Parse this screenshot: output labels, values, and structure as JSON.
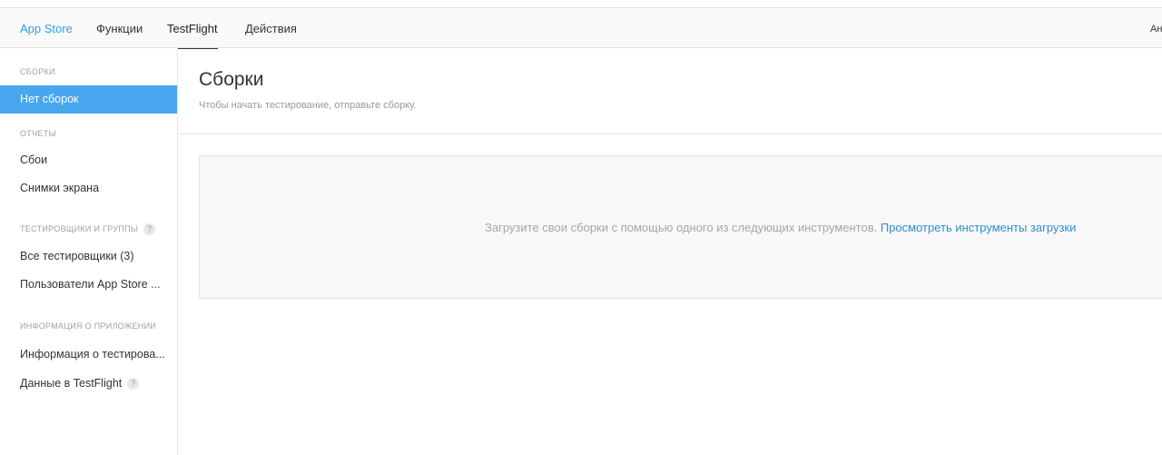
{
  "tabs": [
    {
      "label": "App Store"
    },
    {
      "label": "Функции"
    },
    {
      "label": "TestFlight"
    },
    {
      "label": "Действия"
    }
  ],
  "top_right_clipped": "Ан",
  "sidebar": {
    "sections": [
      {
        "title": "СБОРКИ"
      },
      {
        "title": "ОТЧЕТЫ"
      },
      {
        "title": "ТЕСТИРОВЩИКИ И ГРУППЫ"
      },
      {
        "title": "ИНФОРМАЦИЯ О ПРИЛОЖЕНИИ"
      }
    ],
    "items": [
      {
        "label": "Нет сборок"
      },
      {
        "label": "Сбои"
      },
      {
        "label": "Снимки экрана"
      },
      {
        "label": "Все тестировщики (3)"
      },
      {
        "label": "Пользователи App Store ..."
      },
      {
        "label": "Информация о тестирова..."
      },
      {
        "label": "Данные в TestFlight"
      }
    ],
    "help_glyph": "?"
  },
  "main": {
    "title": "Сборки",
    "subtitle": "Чтобы начать тестирование, отправьте сборку.",
    "panel_text": "Загрузите свои сборки с помощью одного из следующих инструментов.",
    "panel_link": "Просмотреть инструменты загрузки"
  },
  "colors": {
    "accent": "#2c9fe0",
    "selected_bg": "#47a6ee",
    "link": "#2c8fd1"
  }
}
